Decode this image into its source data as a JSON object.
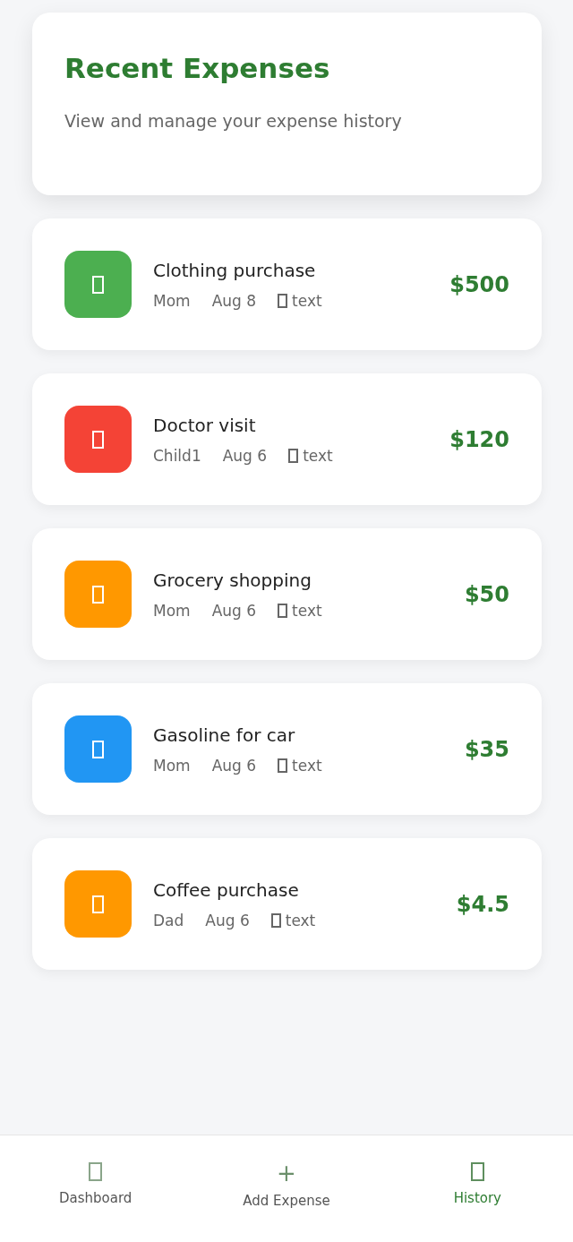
{
  "header": {
    "title": "Recent Expenses",
    "subtitle": "View and manage your expense history"
  },
  "expenses": [
    {
      "title": "Clothing purchase",
      "person": "Mom",
      "date": "Aug 8",
      "note": "text",
      "amount": "$500",
      "color": "#4caf50"
    },
    {
      "title": "Doctor visit",
      "person": "Child1",
      "date": "Aug 6",
      "note": "text",
      "amount": "$120",
      "color": "#f44336"
    },
    {
      "title": "Grocery shopping",
      "person": "Mom",
      "date": "Aug 6",
      "note": "text",
      "amount": "$50",
      "color": "#ff9800"
    },
    {
      "title": "Gasoline for car",
      "person": "Mom",
      "date": "Aug 6",
      "note": "text",
      "amount": "$35",
      "color": "#2196f3"
    },
    {
      "title": "Coffee purchase",
      "person": "Dad",
      "date": "Aug 6",
      "note": "text",
      "amount": "$4.5",
      "color": "#ff9800"
    }
  ],
  "nav": [
    {
      "label": "Dashboard",
      "kind": "box",
      "selected": false
    },
    {
      "label": "Add Expense",
      "kind": "text",
      "icon": "+",
      "selected": false
    },
    {
      "label": "History",
      "kind": "box",
      "selected": true
    }
  ]
}
